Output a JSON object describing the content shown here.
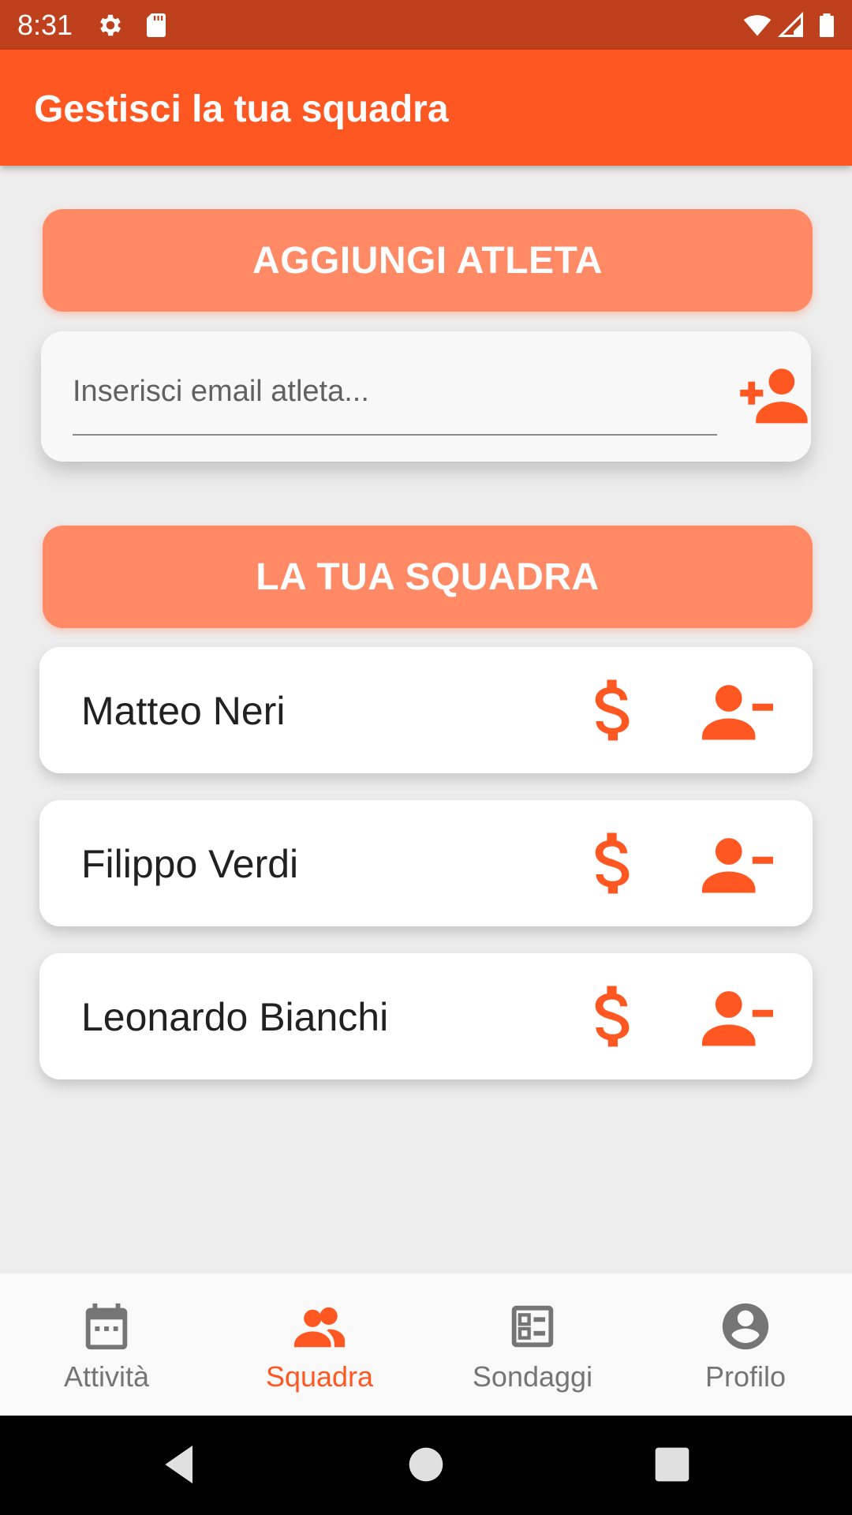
{
  "status_bar": {
    "time": "8:31",
    "icons": [
      "gear-icon",
      "sd-card-icon",
      "wifi-icon",
      "signal-icon",
      "battery-icon"
    ]
  },
  "app_bar": {
    "title": "Gestisci la tua squadra"
  },
  "add_section": {
    "header": "AGGIUNGI ATLETA",
    "email_placeholder": "Inserisci email atleta...",
    "email_value": "",
    "add_icon": "person-add-icon"
  },
  "team_section": {
    "header": "LA TUA SQUADRA",
    "athletes": [
      {
        "name": "Matteo Neri"
      },
      {
        "name": "Filippo Verdi"
      },
      {
        "name": "Leonardo Bianchi"
      }
    ],
    "row_icons": [
      "dollar-icon",
      "person-remove-icon"
    ]
  },
  "bottom_nav": {
    "items": [
      {
        "label": "Attività",
        "icon": "calendar-icon",
        "active": false
      },
      {
        "label": "Squadra",
        "icon": "group-icon",
        "active": true
      },
      {
        "label": "Sondaggi",
        "icon": "poll-icon",
        "active": false
      },
      {
        "label": "Profilo",
        "icon": "account-circle-icon",
        "active": false
      }
    ]
  },
  "colors": {
    "primary": "#FF5722",
    "primary_dark": "#BF401D",
    "header_light": "#FF8A65",
    "inactive": "#757575"
  }
}
